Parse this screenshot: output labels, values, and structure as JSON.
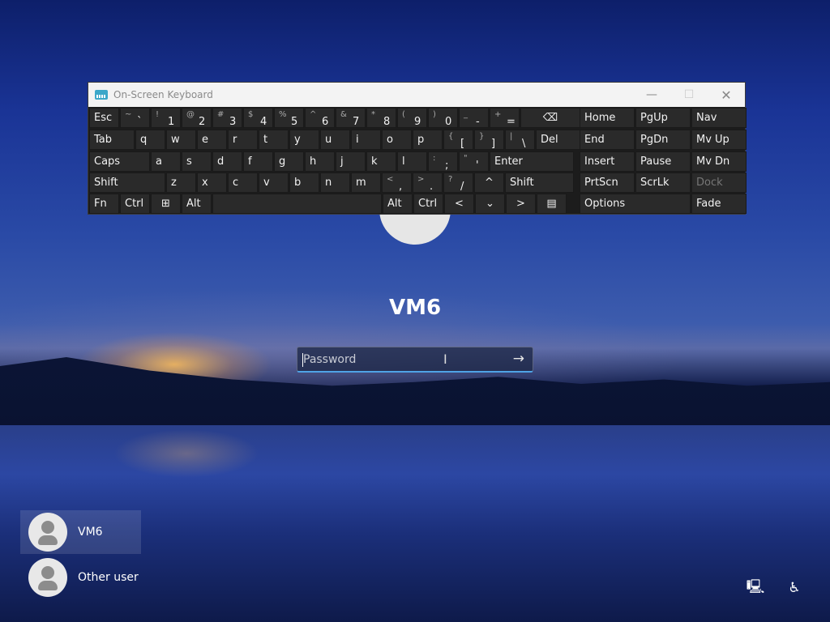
{
  "osk": {
    "title": "On-Screen Keyboard",
    "minimize_glyph": "—",
    "maximize_glyph": "☐",
    "close_glyph": "✕",
    "rows": [
      [
        {
          "label": "Esc"
        },
        {
          "shift": "~",
          "main": "`"
        },
        {
          "shift": "!",
          "main": "1"
        },
        {
          "shift": "@",
          "main": "2"
        },
        {
          "shift": "#",
          "main": "3"
        },
        {
          "shift": "$",
          "main": "4"
        },
        {
          "shift": "%",
          "main": "5"
        },
        {
          "shift": "^",
          "main": "6"
        },
        {
          "shift": "&",
          "main": "7"
        },
        {
          "shift": "*",
          "main": "8"
        },
        {
          "shift": "(",
          "main": "9"
        },
        {
          "shift": ")",
          "main": "0"
        },
        {
          "shift": "_",
          "main": "-"
        },
        {
          "shift": "+",
          "main": "="
        },
        {
          "label": "⌫"
        },
        {
          "label": "Home"
        },
        {
          "label": "PgUp"
        },
        {
          "label": "Nav"
        }
      ],
      [
        {
          "label": "Tab"
        },
        {
          "label": "q"
        },
        {
          "label": "w"
        },
        {
          "label": "e"
        },
        {
          "label": "r"
        },
        {
          "label": "t"
        },
        {
          "label": "y"
        },
        {
          "label": "u"
        },
        {
          "label": "i"
        },
        {
          "label": "o"
        },
        {
          "label": "p"
        },
        {
          "shift": "{",
          "main": "["
        },
        {
          "shift": "}",
          "main": "]"
        },
        {
          "shift": "|",
          "main": "\\"
        },
        {
          "label": "Del"
        },
        {
          "label": "End"
        },
        {
          "label": "PgDn"
        },
        {
          "label": "Mv Up"
        }
      ],
      [
        {
          "label": "Caps"
        },
        {
          "label": "a"
        },
        {
          "label": "s"
        },
        {
          "label": "d"
        },
        {
          "label": "f"
        },
        {
          "label": "g"
        },
        {
          "label": "h"
        },
        {
          "label": "j"
        },
        {
          "label": "k"
        },
        {
          "label": "l"
        },
        {
          "shift": ":",
          "main": ";"
        },
        {
          "shift": "\"",
          "main": "'"
        },
        {
          "label": "Enter"
        },
        {
          "label": "Insert"
        },
        {
          "label": "Pause"
        },
        {
          "label": "Mv Dn"
        }
      ],
      [
        {
          "label": "Shift"
        },
        {
          "label": "z"
        },
        {
          "label": "x"
        },
        {
          "label": "c"
        },
        {
          "label": "v"
        },
        {
          "label": "b"
        },
        {
          "label": "n"
        },
        {
          "label": "m"
        },
        {
          "shift": "<",
          "main": ","
        },
        {
          "shift": ">",
          "main": "."
        },
        {
          "shift": "?",
          "main": "/"
        },
        {
          "label": "^"
        },
        {
          "label": "Shift"
        },
        {
          "label": "PrtScn"
        },
        {
          "label": "ScrLk"
        },
        {
          "label": "Dock"
        }
      ],
      [
        {
          "label": "Fn"
        },
        {
          "label": "Ctrl"
        },
        {
          "label": "⊞"
        },
        {
          "label": "Alt"
        },
        {
          "label": ""
        },
        {
          "label": "Alt"
        },
        {
          "label": "Ctrl"
        },
        {
          "label": "<"
        },
        {
          "label": "⌄"
        },
        {
          "label": ">"
        },
        {
          "label": "▤"
        },
        {
          "label": "Options"
        },
        {
          "label": "Fade"
        }
      ]
    ]
  },
  "login": {
    "username": "VM6",
    "password_placeholder": "Password",
    "ibeam_glyph": "I",
    "submit_glyph": "→"
  },
  "users": [
    {
      "name": "VM6"
    },
    {
      "name": "Other user"
    }
  ],
  "corner_icons": {
    "network": "🖳",
    "accessibility": "♿"
  }
}
